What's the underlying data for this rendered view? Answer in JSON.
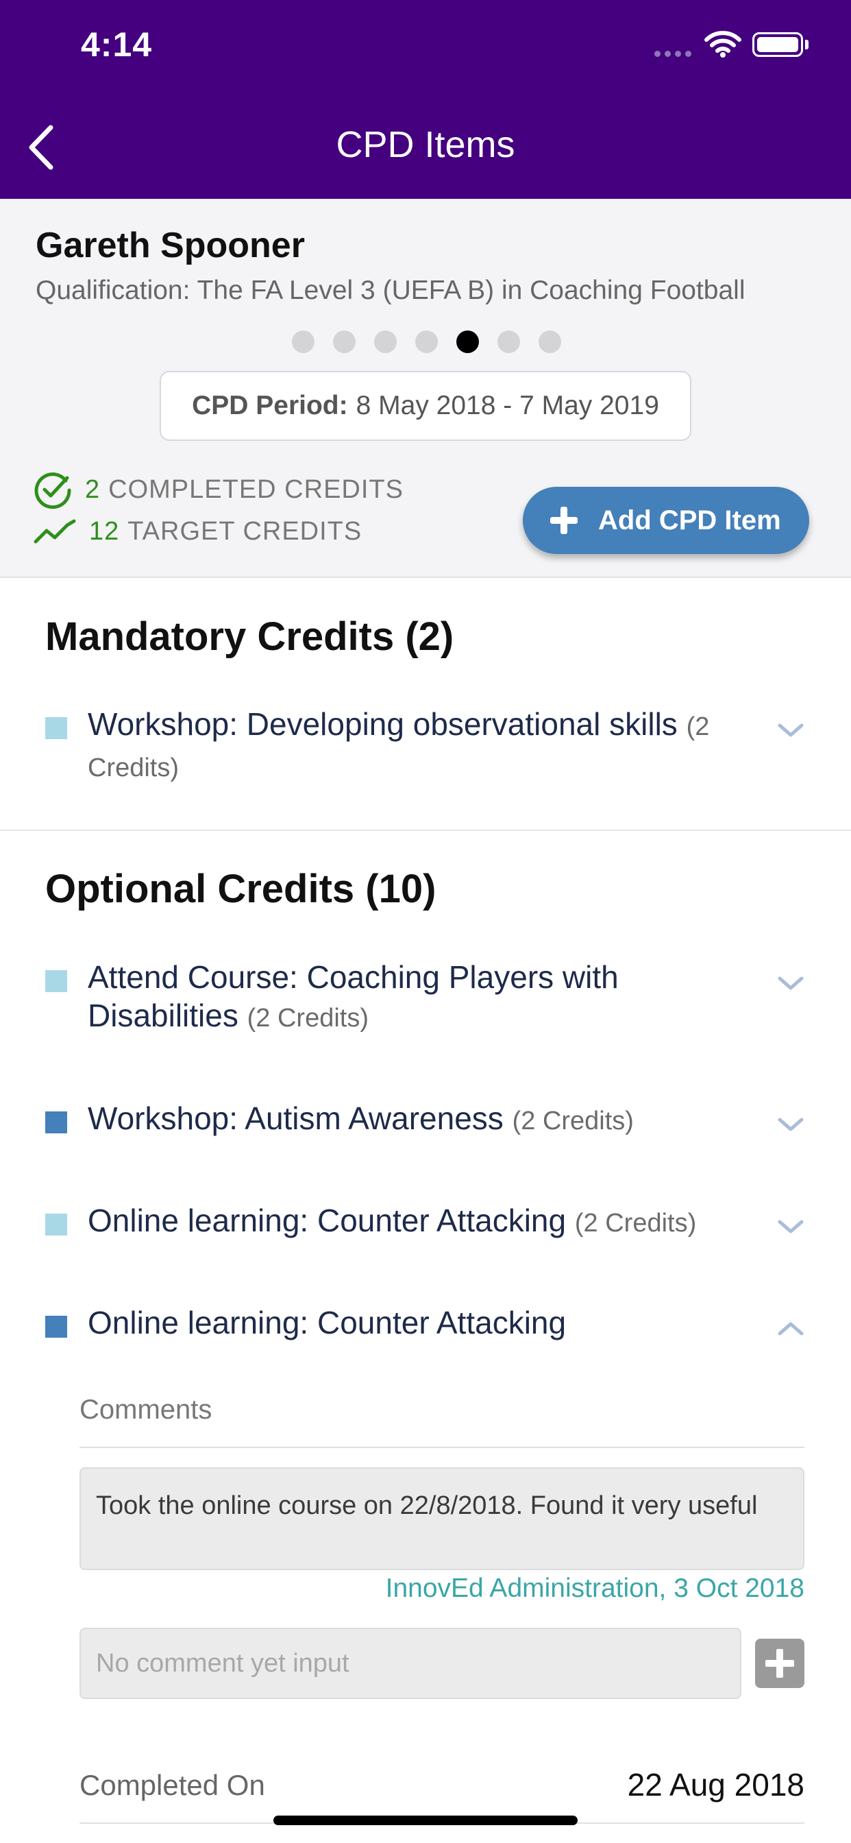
{
  "status_bar": {
    "time": "4:14"
  },
  "nav": {
    "title": "CPD Items"
  },
  "profile": {
    "name": "Gareth Spooner",
    "qualification": "Qualification: The FA Level 3 (UEFA B) in Coaching Football",
    "page_dots_total": 7,
    "page_dots_active_index": 4,
    "period_label": "CPD Period:",
    "period_value": "8 May 2018 - 7 May 2019",
    "completed_num": "2",
    "completed_label": "COMPLETED CREDITS",
    "target_num": "12",
    "target_label": "TARGET CREDITS",
    "add_button_label": "Add CPD Item"
  },
  "mandatory": {
    "title": "Mandatory Credits (2)",
    "items": [
      {
        "label": "Workshop: Developing observational skills",
        "credits": "(2 Credits)",
        "marker": "light",
        "expanded": false
      }
    ]
  },
  "optional": {
    "title": "Optional Credits (10)",
    "items": [
      {
        "label": "Attend Course: Coaching Players with Disabilities",
        "credits": "(2 Credits)",
        "marker": "light",
        "expanded": false
      },
      {
        "label": "Workshop: Autism Awareness",
        "credits": "(2 Credits)",
        "marker": "dark",
        "expanded": false
      },
      {
        "label": "Online learning: Counter Attacking",
        "credits": "(2 Credits)",
        "marker": "light",
        "expanded": false
      },
      {
        "label": "Online learning: Counter Attacking",
        "credits": "",
        "marker": "dark",
        "expanded": true
      }
    ]
  },
  "detail": {
    "comments_label": "Comments",
    "comment_text": "Took the online course on 22/8/2018. Found it very useful",
    "comment_meta": "InnovEd Administration, 3 Oct 2018",
    "input_placeholder": "No comment yet input",
    "completed_label": "Completed On",
    "completed_value": "22 Aug 2018"
  },
  "colors": {
    "nav_bg": "#44007f",
    "accent_blue": "#4480ba",
    "marker_light": "#a8d8e6",
    "green": "#2f8f1c",
    "meta_teal": "#3aa6a6"
  }
}
